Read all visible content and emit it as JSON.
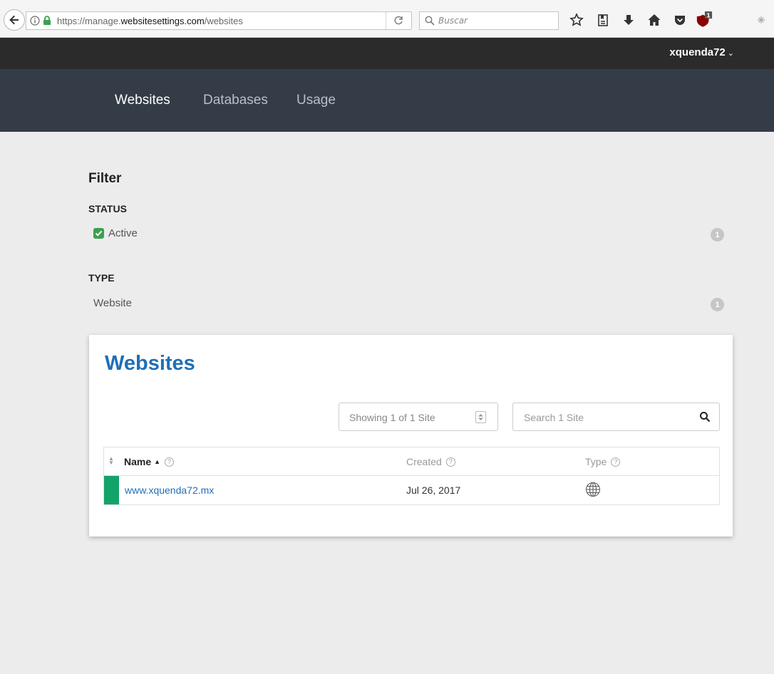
{
  "browser": {
    "url_prefix": "https://manage.",
    "url_domain": "websitesettings.com",
    "url_path": "/websites",
    "search_placeholder": "Buscar",
    "ublock_badge": "1"
  },
  "header": {
    "username": "xquenda72",
    "nav": [
      {
        "label": "Websites",
        "active": true
      },
      {
        "label": "Databases",
        "active": false
      },
      {
        "label": "Usage",
        "active": false
      }
    ]
  },
  "filter": {
    "title": "Filter",
    "status_label": "STATUS",
    "status_option": {
      "label": "Active",
      "checked": true,
      "count": "1"
    },
    "type_label": "TYPE",
    "type_option": {
      "label": "Website",
      "count": "1"
    }
  },
  "websites": {
    "title": "Websites",
    "showing": "Showing 1 of 1 Site",
    "search_placeholder": "Search 1 Site",
    "columns": {
      "name": "Name",
      "created": "Created",
      "type": "Type"
    },
    "help_glyph": "?",
    "rows": [
      {
        "name": "www.xquenda72.mx",
        "created": "Jul 26, 2017",
        "type_icon": "globe-icon",
        "status_color": "#12a36b"
      }
    ]
  },
  "colors": {
    "accent": "#1f6fb5",
    "nav_bg": "#343d47",
    "status_active": "#12a36b"
  }
}
